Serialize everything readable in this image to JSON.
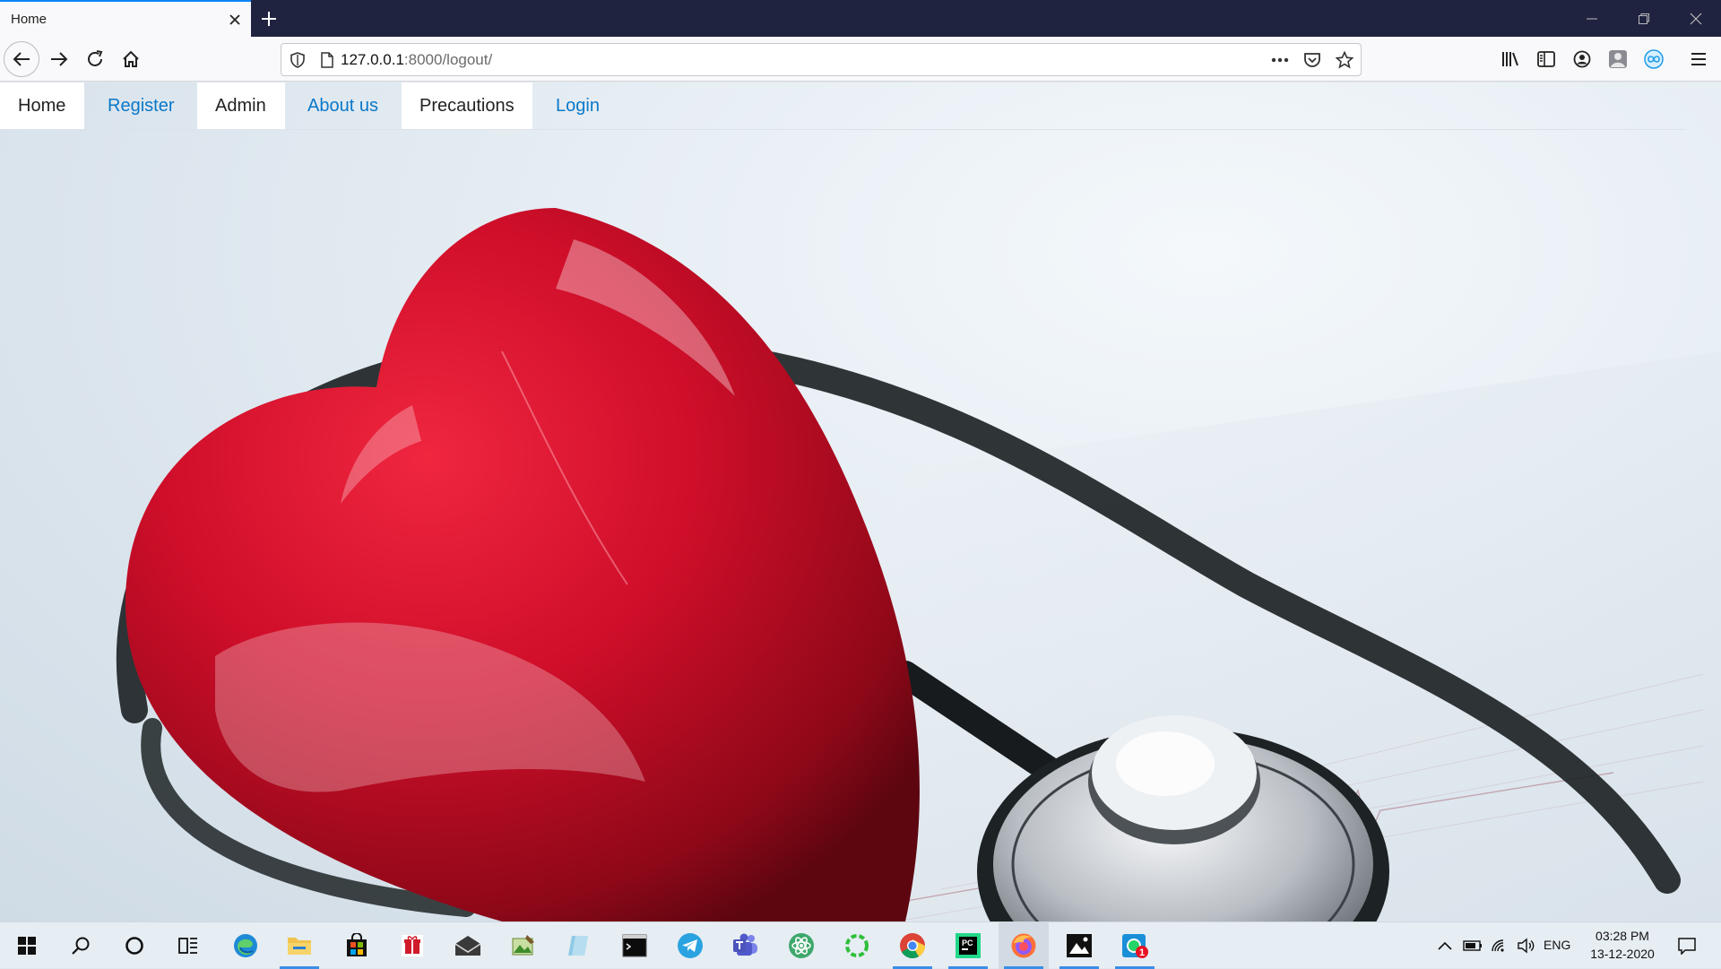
{
  "browser": {
    "tab_title": "Home",
    "url_host": "127.0.0.1",
    "url_path": ":8000/logout/"
  },
  "nav": {
    "items": [
      {
        "label": "Home"
      },
      {
        "label": "Register"
      },
      {
        "label": "Admin"
      },
      {
        "label": "About us"
      },
      {
        "label": "Precautions"
      },
      {
        "label": "Login"
      }
    ]
  },
  "hero": {
    "subject": "red glossy heart with stethoscope on ECG paper"
  },
  "taskbar": {
    "apps": [
      "start-icon",
      "search-icon",
      "cortana-icon",
      "task-view-icon",
      "edge-icon",
      "file-explorer-icon",
      "store-icon",
      "gift-icon",
      "mail-icon",
      "photos-icon",
      "notepad-icon",
      "terminal-icon",
      "telegram-icon",
      "teams-icon",
      "atom-icon",
      "refresh-app-icon",
      "chrome-icon",
      "pycharm-icon",
      "firefox-icon",
      "photos-viewer-icon",
      "whatsapp-icon"
    ],
    "badge": "1",
    "language": "ENG",
    "time": "03:28 PM",
    "date": "13-12-2020"
  },
  "colors": {
    "link": "#0a78c9",
    "tab_accent": "#0a84ff",
    "titlebar": "#202340",
    "heart": "#c8102e"
  }
}
